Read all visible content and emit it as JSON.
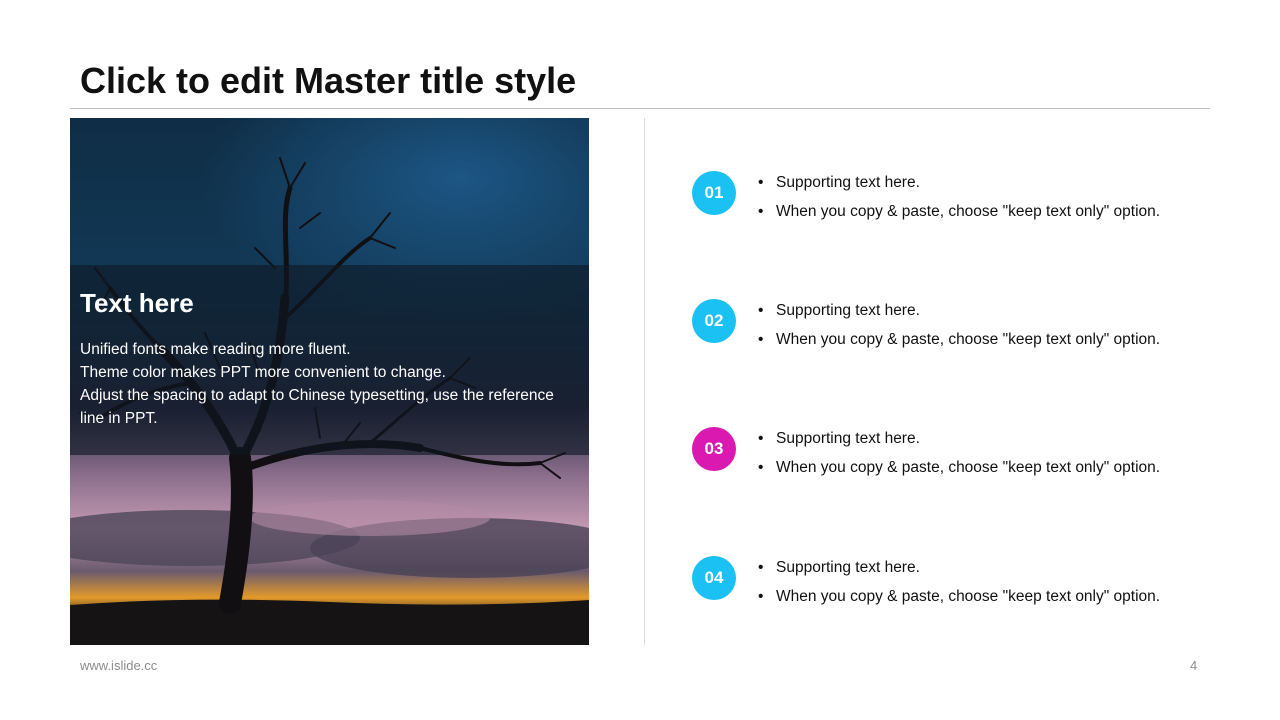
{
  "slide": {
    "title": "Click to edit Master title style",
    "footer_url": "www.islide.cc",
    "page_number": "4"
  },
  "photo_card": {
    "heading": "Text here",
    "lines": [
      "Unified fonts make reading more fluent.",
      "Theme color makes PPT more convenient to change.",
      "Adjust the spacing to adapt to Chinese typesetting, use the reference line in PPT."
    ]
  },
  "items": [
    {
      "number": "01",
      "color": "#1AC1F2",
      "bullet_1": "Supporting text here.",
      "bullet_2": "When you copy & paste, choose \"keep text only\" option."
    },
    {
      "number": "02",
      "color": "#1AC1F2",
      "bullet_1": "Supporting text here.",
      "bullet_2": "When you copy & paste, choose \"keep text only\" option."
    },
    {
      "number": "03",
      "color": "#D919B0",
      "bullet_1": "Supporting text here.",
      "bullet_2": "When you copy & paste, choose \"keep text only\" option."
    },
    {
      "number": "04",
      "color": "#1AC1F2",
      "bullet_1": "Supporting text here.",
      "bullet_2": "When you copy & paste, choose \"keep text only\" option."
    }
  ]
}
